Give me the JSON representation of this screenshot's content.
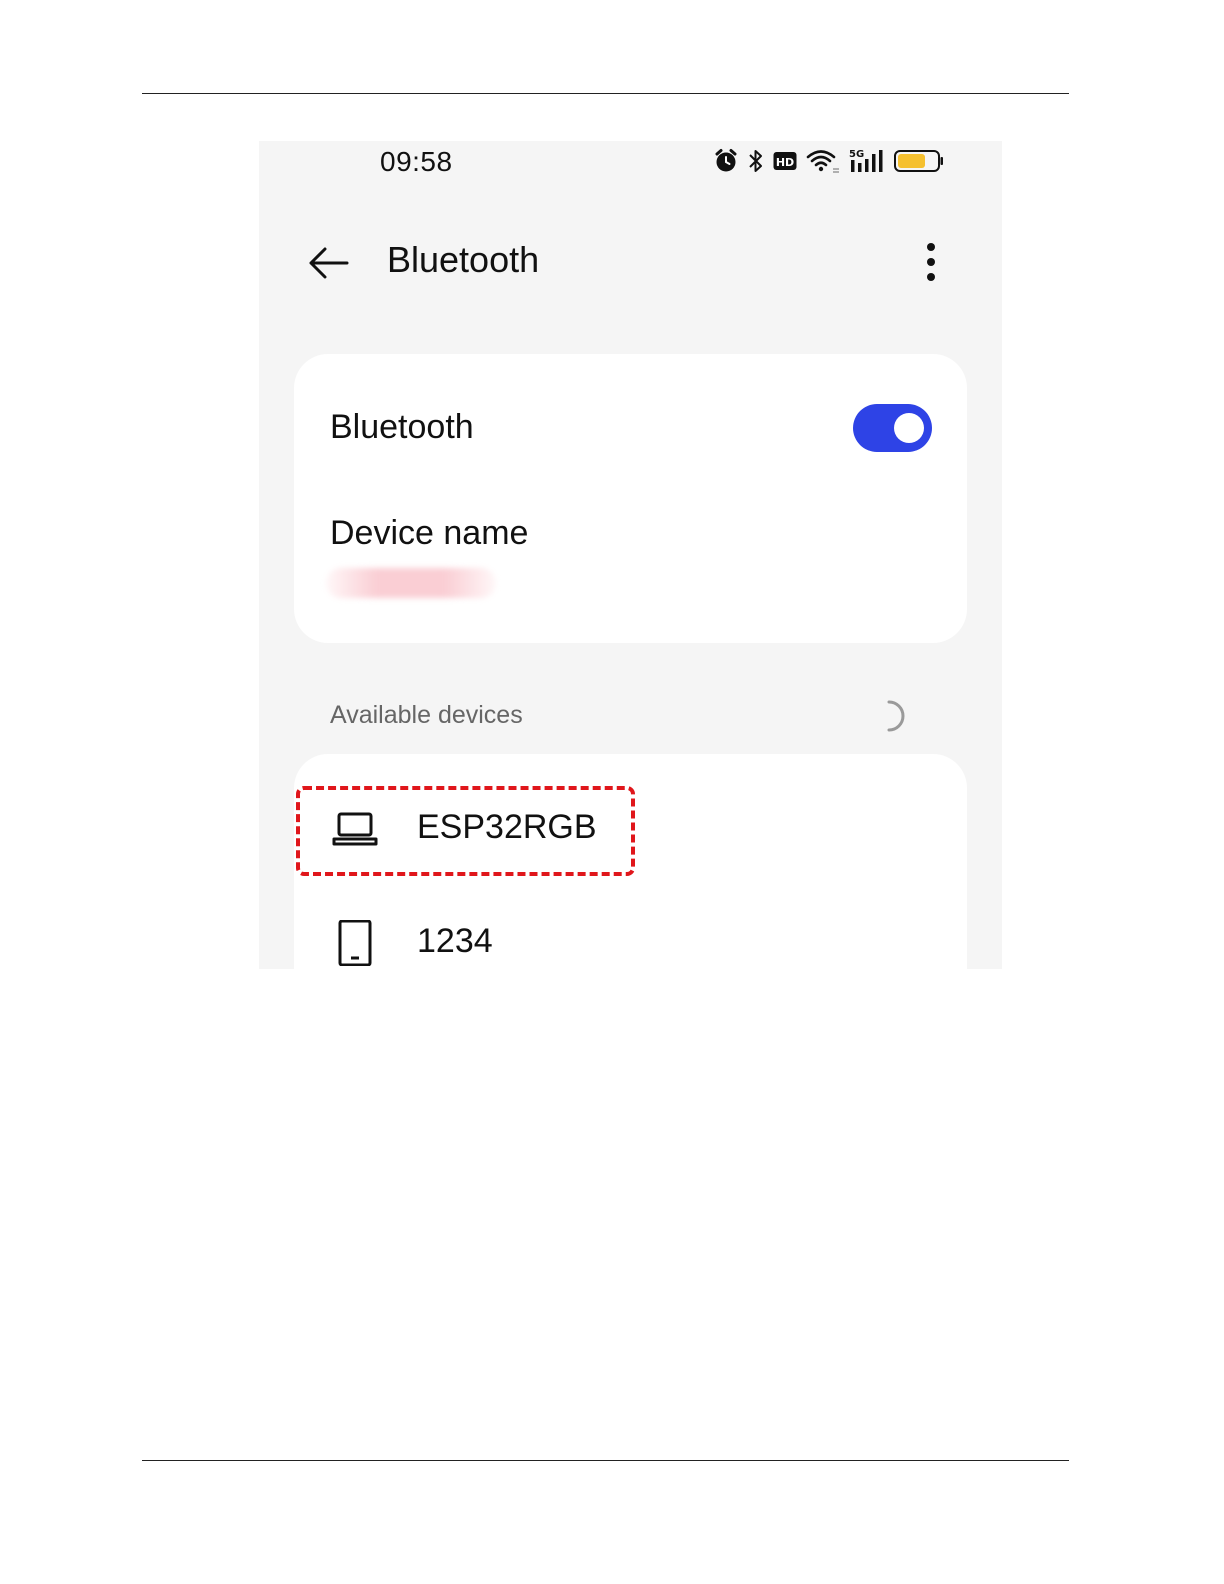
{
  "status_bar": {
    "time": "09:58",
    "icons": [
      "alarm-icon",
      "bluetooth-icon",
      "hd-icon",
      "wifi-icon",
      "5g-signal-icon",
      "battery-icon"
    ],
    "battery_color": "#f5c02f"
  },
  "header": {
    "title": "Bluetooth",
    "back_icon": "back-arrow-icon",
    "menu_icon": "more-vert-icon"
  },
  "settings": {
    "bluetooth_label": "Bluetooth",
    "bluetooth_enabled": true,
    "toggle_color": "#2e43e6",
    "device_name_label": "Device name"
  },
  "available": {
    "label": "Available devices",
    "devices": [
      {
        "name": "ESP32RGB",
        "icon": "laptop-icon",
        "highlighted": true
      },
      {
        "name": "1234",
        "icon": "phone-icon",
        "highlighted": false
      }
    ],
    "highlight_color": "#e0161b"
  }
}
